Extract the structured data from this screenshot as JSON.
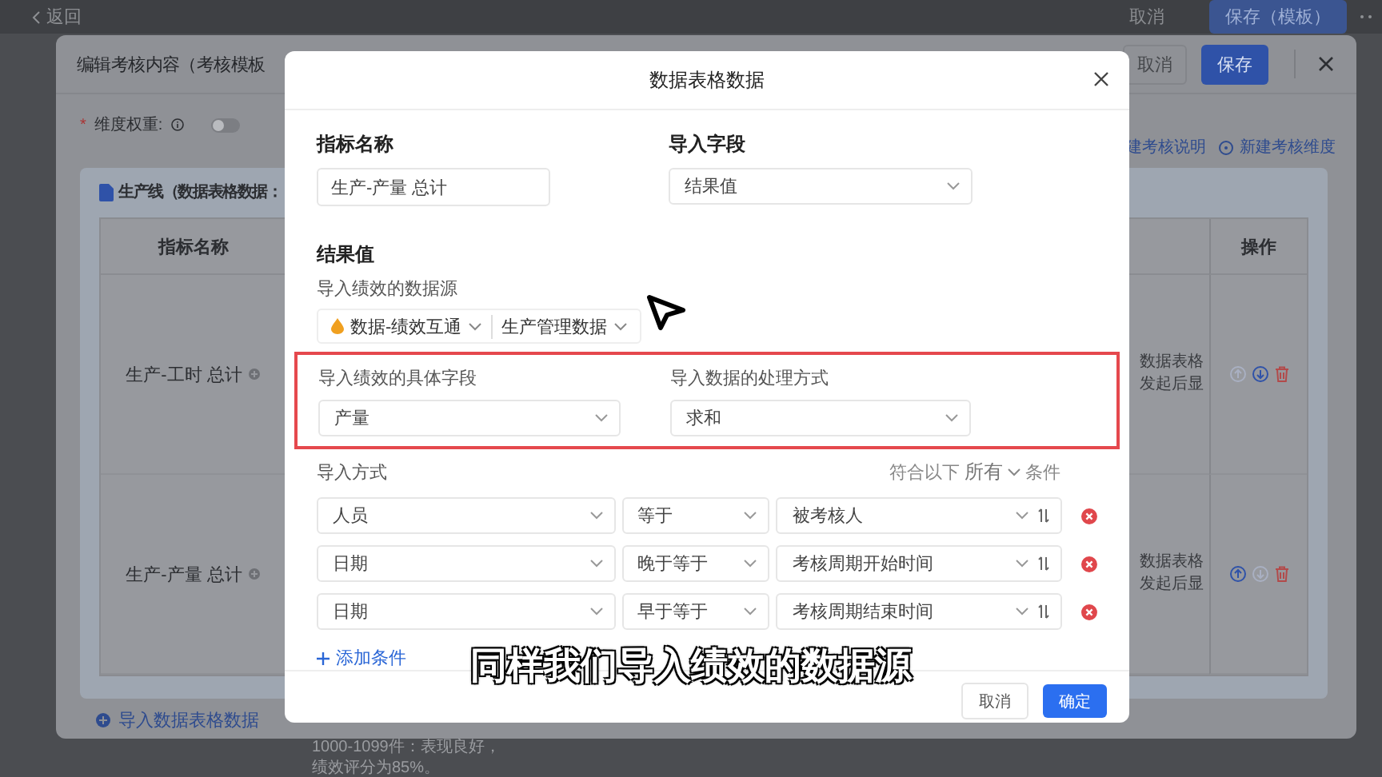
{
  "top_bar": {
    "back": "返回",
    "cancel": "取消",
    "save": "保存（模板）"
  },
  "drawer": {
    "title": "编辑考核内容（考核模板",
    "cancel": "取消",
    "save": "保存",
    "weight": {
      "required_mark": "*",
      "label": "维度权重:",
      "on": false
    },
    "links": [
      "建考核说明",
      "新建考核维度"
    ],
    "card_title": "生产线（数据表格数据：",
    "table": {
      "columns": [
        "指标名称",
        "操作"
      ],
      "rows": [
        {
          "name": "生产-工时 总计",
          "note": "数据表格发起后显",
          "up_disabled": true,
          "down_disabled": false
        },
        {
          "name": "生产-产量 总计",
          "note": "数据表格发起后显",
          "up_disabled": false,
          "down_disabled": true
        }
      ]
    },
    "import_link": "导入数据表格数据"
  },
  "background_text": [
    "1000-1099件：表现良好，",
    "绩效评分为85%。"
  ],
  "modal": {
    "title": "数据表格数据",
    "name_field": {
      "label": "指标名称",
      "value": "生产-产量 总计"
    },
    "import_field": {
      "label": "导入字段",
      "value": "结果值"
    },
    "section_title": "结果值",
    "source_label": "导入绩效的数据源",
    "sources": [
      {
        "label": "数据-绩效互通",
        "has_icon": true
      },
      {
        "label": "生产管理数据",
        "has_icon": false
      }
    ],
    "highlighted": true,
    "detail_field": {
      "label": "导入绩效的具体字段",
      "value": "产量"
    },
    "method_field": {
      "label": "导入数据的处理方式",
      "value": "求和"
    },
    "import_mode": {
      "label": "导入方式",
      "match_prefix": "符合以下",
      "match": "所有",
      "match_suffix": "条件"
    },
    "conditions": [
      {
        "field": "人员",
        "op": "等于",
        "value": "被考核人"
      },
      {
        "field": "日期",
        "op": "晚于等于",
        "value": "考核周期开始时间"
      },
      {
        "field": "日期",
        "op": "早于等于",
        "value": "考核周期结束时间"
      }
    ],
    "add_condition": "添加条件",
    "cancel": "取消",
    "ok": "确定"
  },
  "subtitle": "同样我们导入绩效的数据源"
}
